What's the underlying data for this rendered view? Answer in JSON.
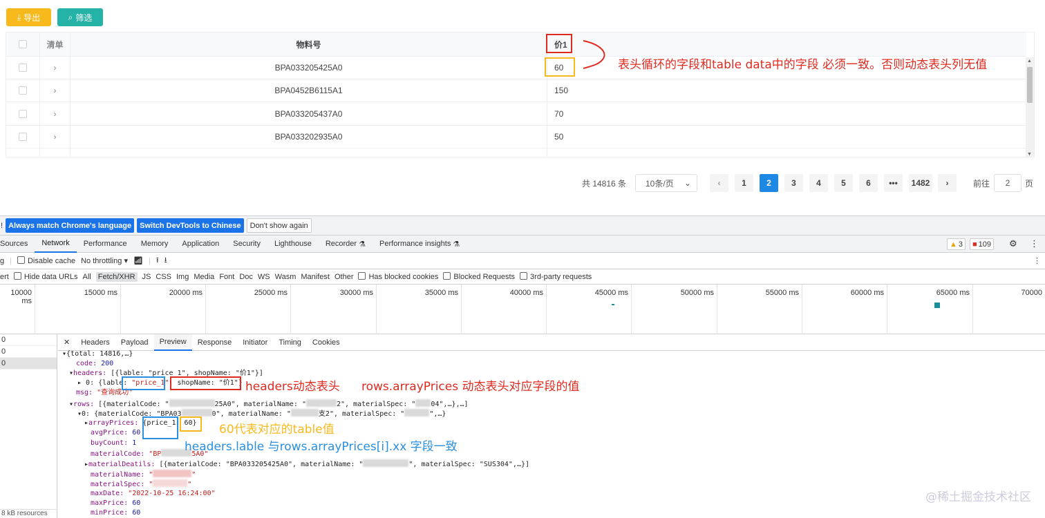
{
  "toolbar": {
    "export_label": "导出",
    "filter_label": "筛选"
  },
  "table": {
    "headers": {
      "list": "清单",
      "material": "物料号",
      "price": "价1"
    },
    "rows": [
      {
        "material": "BPA033205425A0",
        "price": "60"
      },
      {
        "material": "BPA0452B6115A1",
        "price": "150"
      },
      {
        "material": "BPA033205437A0",
        "price": "70"
      },
      {
        "material": "BPA033202935A0",
        "price": "50"
      }
    ]
  },
  "pagination": {
    "total": "共 14816 条",
    "page_size": "10条/页",
    "pages": [
      "1",
      "2",
      "3",
      "4",
      "5",
      "6",
      "•••",
      "1482"
    ],
    "active_page": "2",
    "goto_label": "前往",
    "goto_value": "2",
    "goto_suffix": "页"
  },
  "annotations": {
    "top": "表头循环的字段和table data中的字段 必须一致。否则动态表头列无值",
    "headers": "headers动态表头",
    "rows": "rows.arrayPrices 动态表头对应字段的值",
    "sixty": "60代表对应的table值",
    "match": "headers.lable 与rows.arrayPrices[i].xx 字段一致"
  },
  "devtools": {
    "infobar": {
      "match_language": "Always match Chrome's language",
      "switch_chinese": "Switch DevTools to Chinese",
      "dont_show": "Don't show again"
    },
    "tabs": [
      "Sources",
      "Network",
      "Performance",
      "Memory",
      "Application",
      "Security",
      "Lighthouse",
      "Recorder",
      "Performance insights"
    ],
    "active_tab": "Network",
    "warnings": "3",
    "errors": "109",
    "tools": {
      "disable_cache": "Disable cache",
      "throttling": "No throttling"
    },
    "filters": {
      "hide_data_urls": "Hide data URLs",
      "types": [
        "All",
        "Fetch/XHR",
        "JS",
        "CSS",
        "Img",
        "Media",
        "Font",
        "Doc",
        "WS",
        "Wasm",
        "Manifest",
        "Other"
      ],
      "has_blocked": "Has blocked cookies",
      "blocked_requests": "Blocked Requests",
      "third_party": "3rd-party requests"
    },
    "timeline_ticks": [
      "10000 ms",
      "15000 ms",
      "20000 ms",
      "25000 ms",
      "30000 ms",
      "35000 ms",
      "40000 ms",
      "45000 ms",
      "50000 ms",
      "55000 ms",
      "60000 ms",
      "65000 ms",
      "70000"
    ],
    "request_items": [
      "0",
      "0",
      "0"
    ],
    "footer": "8 kB resources",
    "detail_tabs": [
      "Headers",
      "Payload",
      "Preview",
      "Response",
      "Initiator",
      "Timing",
      "Cookies"
    ],
    "active_detail": "Preview",
    "code": {
      "l1": "{total: 14816,…}",
      "l2_key": "code: ",
      "l2_val": "200",
      "l3_key": "headers: ",
      "l3_val": "[{lable: \"price_1\", shopName: \"价1\"}]",
      "l4_prefix": "0: {lable: ",
      "l4_lable": "\"price_1\"",
      "l4_shop": "shopName: \"价1\"}",
      "l5_key": "msg: ",
      "l5_val": "\"查询成功\"",
      "l6_key": "rows: ",
      "l6_val": "[{materialCode: \"",
      "l6_mid": "25A0\", materialName: \"",
      "l6_mid2": "2\", materialSpec: \"",
      "l6_end": "04\",…},…]",
      "l7": "0: {materialCode: \"BPA03",
      "l7_mid": "0\", materialName: \"",
      "l7_mid2": "支2\", materialSpec: \"",
      "l7_end": "\",…}",
      "l8_key": "arrayPrices: ",
      "l8_val": "{price_1: 60}",
      "l9_key": "avgPrice: ",
      "l9_val": "60",
      "l10_key": "buyCount: ",
      "l10_val": "1",
      "l11_key": "materialCode: ",
      "l11_val": "\"BP",
      "l11_end": "5A0\"",
      "l12_key": "materialDeatils: ",
      "l12_val": "[{materialCode: \"BPA033205425A0\", materialName: \"",
      "l12_end": "\", materialSpec: \"SUS304\",…}]",
      "l13_key": "materialName: ",
      "l13_val": "\"",
      "l13_end": "\"",
      "l14_key": "materialSpec: ",
      "l14_val": "\"",
      "l14_end": "\"",
      "l15_key": "maxDate: ",
      "l15_val": "\"2022-10-25 16:24:00\"",
      "l16_key": "maxPrice: ",
      "l16_val": "60",
      "l17_key": "minPrice: ",
      "l17_val": "60"
    }
  },
  "watermark": "@稀土掘金技术社区",
  "colors": {
    "export": "#f7b91b",
    "filter": "#26b3a7",
    "active_page": "#1e88e5",
    "annotation_red": "#e02a20",
    "annotation_yellow": "#f7b91b",
    "annotation_blue": "#2a8fe0"
  }
}
